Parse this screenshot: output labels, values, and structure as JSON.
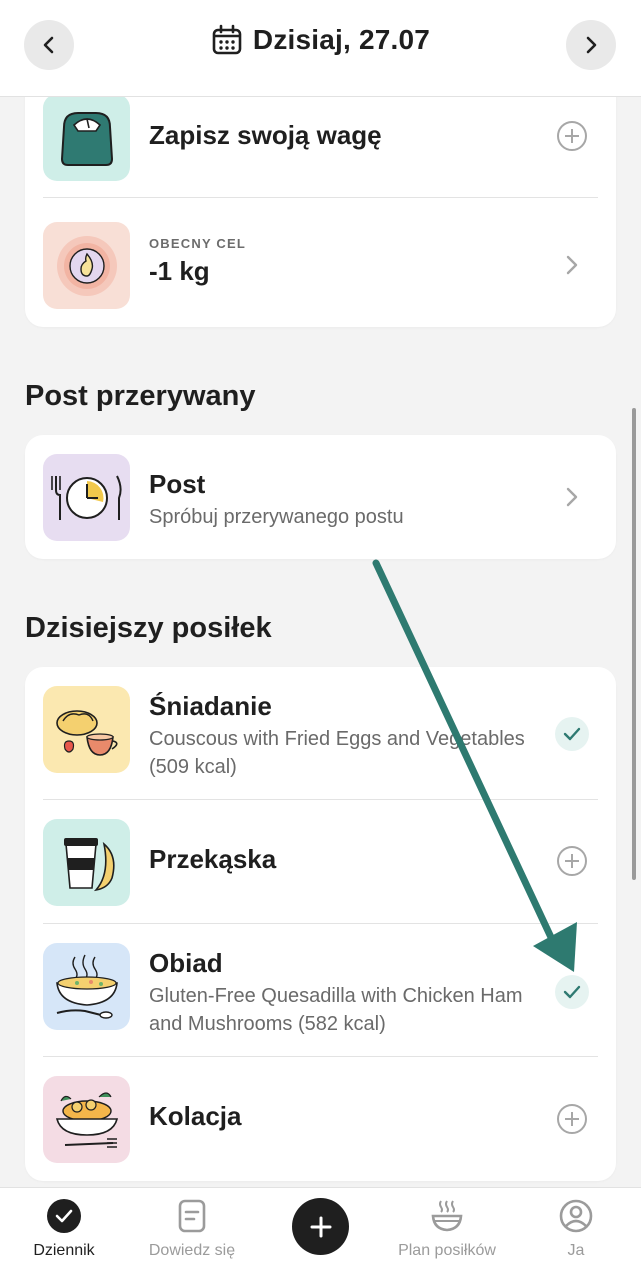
{
  "header": {
    "date_label": "Dzisiaj, 27.07"
  },
  "top_card": {
    "weight_row": {
      "title": "Zapisz swoją wagę",
      "thumb_color": "#cfeee8"
    },
    "goal_row": {
      "eyebrow": "OBECNY CEL",
      "value": "-1 kg",
      "thumb_color": "#f8dfd6"
    }
  },
  "fasting": {
    "section_title": "Post przerywany",
    "row": {
      "title": "Post",
      "subtitle": "Spróbuj przerywanego postu",
      "thumb_color": "#e7ddf1"
    }
  },
  "meals": {
    "section_title": "Dzisiejszy posiłek",
    "items": [
      {
        "title": "Śniadanie",
        "subtitle": "Couscous with Fried Eggs and Vegetables (509 kcal)",
        "status": "done",
        "thumb_color": "#fbe8b0"
      },
      {
        "title": "Przekąska",
        "subtitle": "",
        "status": "add",
        "thumb_color": "#cfeee8"
      },
      {
        "title": "Obiad",
        "subtitle": "Gluten-Free Quesadilla with Chicken Ham and Mushrooms (582 kcal)",
        "status": "done",
        "thumb_color": "#d6e6f8"
      },
      {
        "title": "Kolacja",
        "subtitle": "",
        "status": "add",
        "thumb_color": "#f4dce4"
      }
    ]
  },
  "tabbar": {
    "tabs": [
      {
        "label": "Dziennik",
        "active": true
      },
      {
        "label": "Dowiedz się",
        "active": false
      },
      {
        "label": "Plan posiłków",
        "active": false
      },
      {
        "label": "Ja",
        "active": false
      }
    ]
  },
  "colors": {
    "accent": "#2f7a72",
    "annotation_arrow": "#2e7a70",
    "check_bg": "#e6f3f1"
  }
}
